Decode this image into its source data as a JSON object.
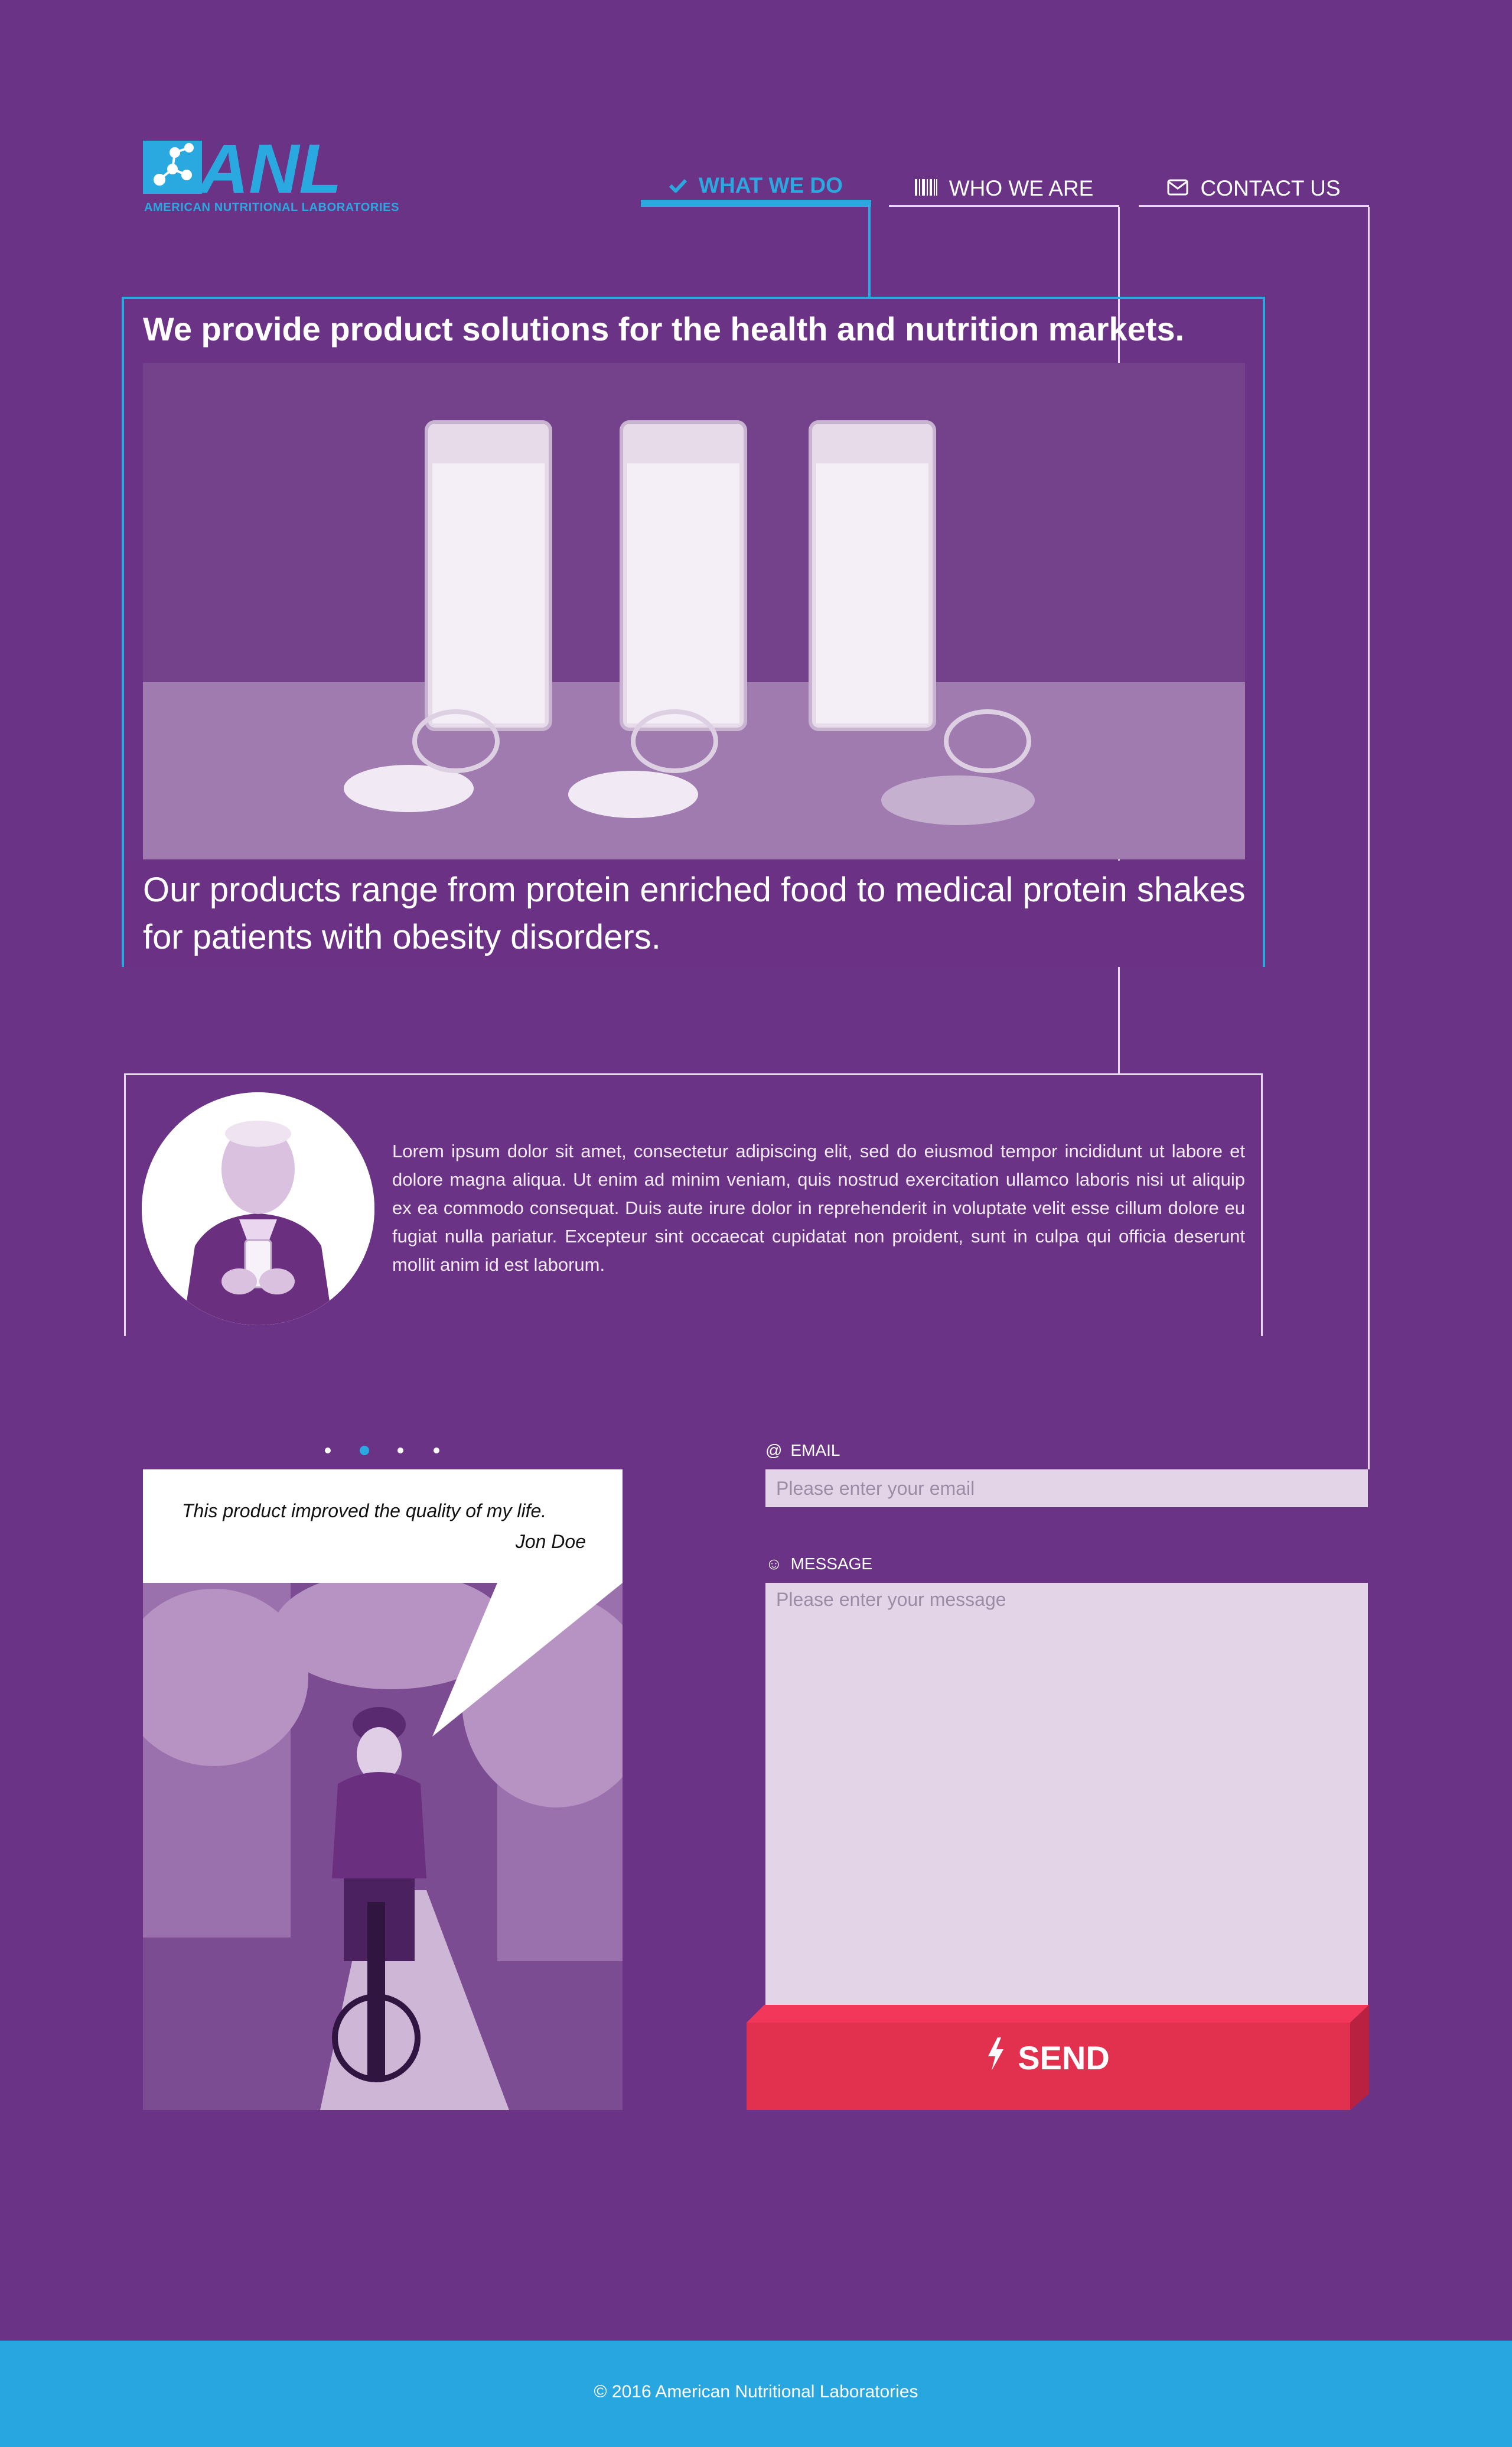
{
  "brand": {
    "logo_text": "ANL",
    "logo_subtitle": "AMERICAN NUTRITIONAL LABORATORIES",
    "accent_color": "#2aa8e0",
    "background_color": "#6b3386"
  },
  "nav": {
    "items": [
      {
        "label": "WHAT WE DO",
        "icon": "check-icon",
        "active": true
      },
      {
        "label": "WHO WE ARE",
        "icon": "barcode-icon",
        "active": false
      },
      {
        "label": "CONTACT US",
        "icon": "envelope-icon",
        "active": false
      }
    ]
  },
  "hero": {
    "title": "We provide product solutions for the health and nutrition markets.",
    "image_alt": "shutterstock",
    "text": "Our products range from protein enriched food to medical protein shakes for patients with obesity disorders."
  },
  "about": {
    "text": "Lorem ipsum dolor sit amet, consectetur adipiscing elit, sed do eiusmod tempor incididunt ut labore et dolore magna aliqua. Ut enim ad minim veniam, quis nostrud exercitation ullamco laboris nisi ut aliquip ex ea commodo consequat. Duis aute irure dolor in reprehenderit in voluptate velit esse cillum dolore eu fugiat nulla pariatur. Excepteur sint occaecat cupidatat non proident, sunt in culpa qui officia deserunt mollit anim id est laborum."
  },
  "testimonial": {
    "slide_count": 4,
    "active_slide": 2,
    "quote": "This product improved the quality of my life.",
    "author": "Jon Doe"
  },
  "form": {
    "email_label": "EMAIL",
    "email_icon": "at-icon",
    "email_placeholder": "Please enter your email",
    "message_label": "MESSAGE",
    "message_icon": "smiley-icon",
    "message_placeholder": "Please enter your message",
    "send_label": "SEND",
    "send_icon": "lightning-icon",
    "send_color": "#e2304f"
  },
  "footer": {
    "text": "© 2016 American Nutritional Laboratories",
    "color": "#28a6e0"
  }
}
